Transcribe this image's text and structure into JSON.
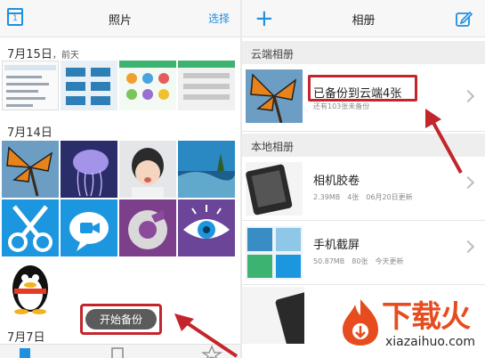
{
  "left": {
    "title": "照片",
    "calendar_day": "1",
    "select_label": "选择",
    "groups": [
      {
        "date": "7月15日",
        "sub": "，前天"
      },
      {
        "date": "7月14日",
        "sub": ""
      },
      {
        "date": "7月7日",
        "sub": ""
      }
    ],
    "backup_button": "开始备份"
  },
  "right": {
    "title": "相册",
    "cloud_header": "云端相册",
    "cloud_album": {
      "name": "已备份到云端4张",
      "meta": "还有103张未备份"
    },
    "local_header": "本地相册",
    "local_albums": [
      {
        "name": "相机胶卷",
        "meta": "2.39MB　4张　06月20日更新"
      },
      {
        "name": "手机截屏",
        "meta": "50.87MB　80张　今天更新"
      }
    ]
  },
  "watermark": {
    "big": "下载火",
    "small": "xiazaihuo.com"
  },
  "colors": {
    "accent": "#1f8fe0",
    "highlight": "#c2262c",
    "logo": "#e64c1e"
  }
}
